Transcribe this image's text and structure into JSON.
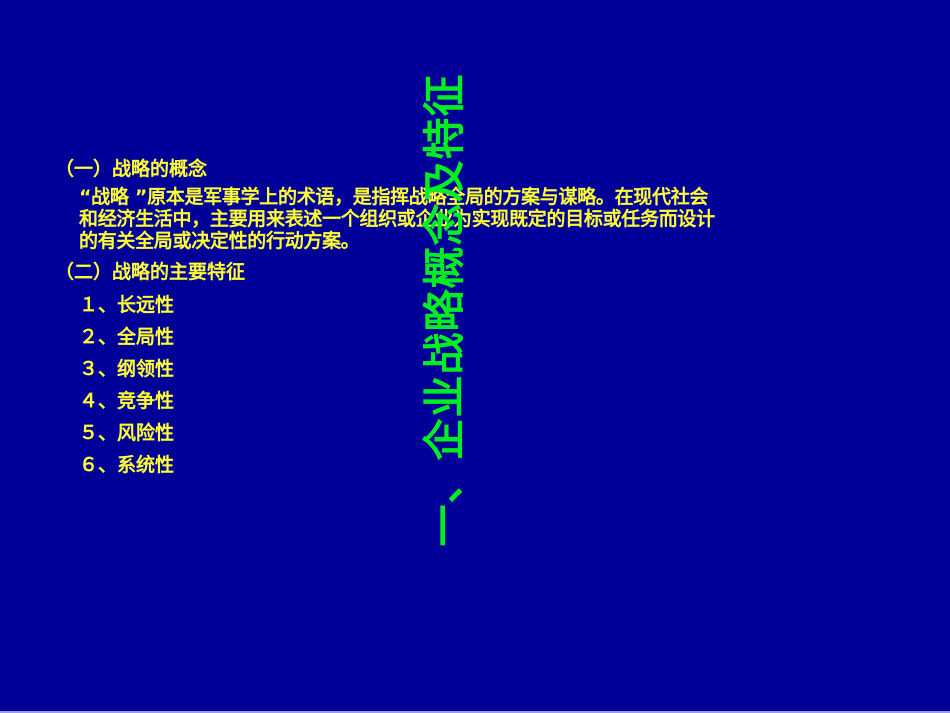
{
  "slide": {
    "title": "一、企业战略概念及特征",
    "colors": {
      "background": "#000099",
      "body_text": "#ffff33",
      "title_text": "#00ee22"
    },
    "section1": {
      "heading": "（一）战略的概念",
      "paragraph_lines": [
        "“战略 ”原本是军事学上的术语，是指挥战略全局的方案与谋略。在现代社会",
        "和经济生活中，主要用来表述一个组织或企业为实现既定的目标或任务而设计",
        "的有关全局或决定性的行动方案。"
      ]
    },
    "section2": {
      "heading": "（二）战略的主要特征",
      "items": [
        "１、长远性",
        "２、全局性",
        "３、纲领性",
        "４、竞争性",
        "５、风险性",
        "６、系统性"
      ]
    }
  }
}
